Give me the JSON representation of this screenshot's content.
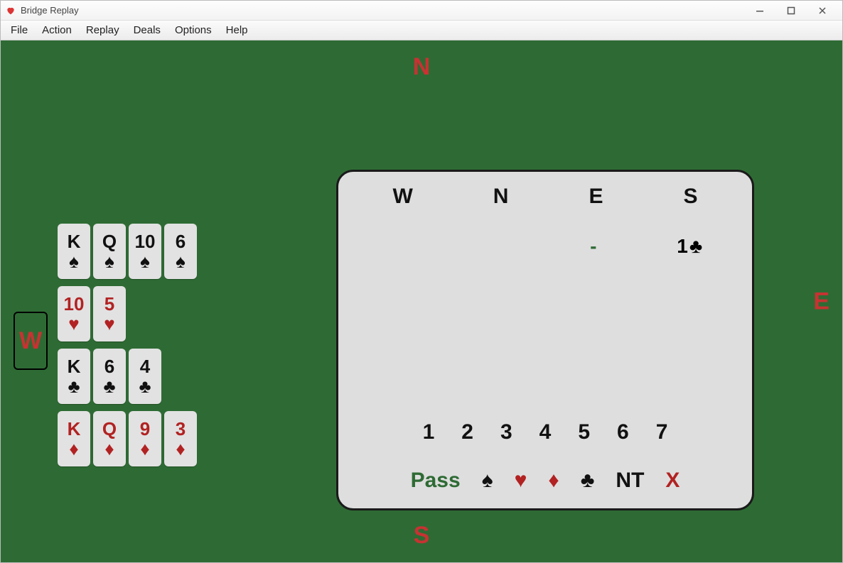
{
  "window": {
    "title": "Bridge Replay"
  },
  "menu": {
    "items": [
      "File",
      "Action",
      "Replay",
      "Deals",
      "Options",
      "Help"
    ]
  },
  "compass": {
    "N": "N",
    "S": "S",
    "E": "E",
    "W": "W"
  },
  "hand": {
    "seat": "W",
    "suits": [
      {
        "suit": "spades",
        "color": "black",
        "glyph": "♠",
        "cards": [
          "K",
          "Q",
          "10",
          "6"
        ]
      },
      {
        "suit": "hearts",
        "color": "red",
        "glyph": "♥",
        "cards": [
          "10",
          "5"
        ]
      },
      {
        "suit": "clubs",
        "color": "black",
        "glyph": "♣",
        "cards": [
          "K",
          "6",
          "4"
        ]
      },
      {
        "suit": "diamonds",
        "color": "red",
        "glyph": "♦",
        "cards": [
          "K",
          "Q",
          "9",
          "3"
        ]
      }
    ]
  },
  "bidding": {
    "headers": [
      "W",
      "N",
      "E",
      "S"
    ],
    "rows": [
      {
        "W": "",
        "N": "",
        "E": "-",
        "S": {
          "level": "1",
          "suit": "clubs",
          "glyph": "♣"
        }
      }
    ],
    "levels": [
      "1",
      "2",
      "3",
      "4",
      "5",
      "6",
      "7"
    ],
    "strains": {
      "pass": "Pass",
      "spade": "♠",
      "heart": "♥",
      "diamond": "♦",
      "club": "♣",
      "nt": "NT",
      "double": "X"
    }
  }
}
